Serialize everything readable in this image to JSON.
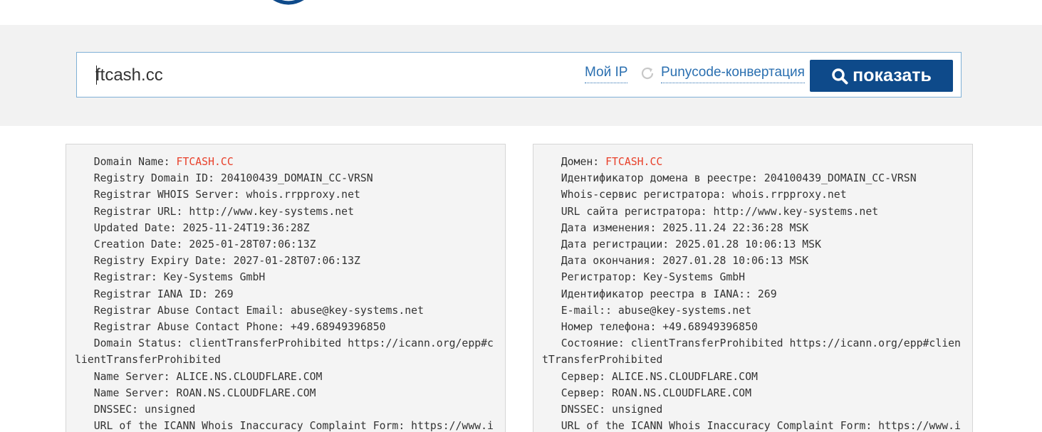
{
  "search": {
    "query": "ftcash.cc",
    "my_ip_label": "Мой IP",
    "punycode_label": "Punycode-конвертация",
    "show_label": "показать"
  },
  "colors": {
    "accent": "#0e4a8a",
    "link": "#2a6fb0",
    "highlight": "#e8402a",
    "band": "#f2f2f2",
    "panel": "#f4f4f4"
  },
  "icons": {
    "logo": "site-logo-arc",
    "refresh": "refresh-icon",
    "search": "search-icon"
  },
  "whois_original": [
    {
      "label": "   Domain Name: ",
      "value": "FTCASH.CC"
    },
    {
      "label": "   Registry Domain ID: 204100439_DOMAIN_CC-VRSN"
    },
    {
      "label": "   Registrar WHOIS Server: whois.rrpproxy.net"
    },
    {
      "label": "   Registrar URL: http://www.key-systems.net"
    },
    {
      "label": "   Updated Date: 2025-11-24T19:36:28Z"
    },
    {
      "label": "   Creation Date: 2025-01-28T07:06:13Z"
    },
    {
      "label": "   Registry Expiry Date: 2027-01-28T07:06:13Z"
    },
    {
      "label": "   Registrar: Key-Systems GmbH"
    },
    {
      "label": "   Registrar IANA ID: 269"
    },
    {
      "label": "   Registrar Abuse Contact Email: abuse@key-systems.net"
    },
    {
      "label": "   Registrar Abuse Contact Phone: +49.68949396850"
    },
    {
      "label": "   Domain Status: clientTransferProhibited https://icann.org/epp#clientTransferProhibited"
    },
    {
      "label": "   Name Server: ALICE.NS.CLOUDFLARE.COM"
    },
    {
      "label": "   Name Server: ROAN.NS.CLOUDFLARE.COM"
    },
    {
      "label": "   DNSSEC: unsigned"
    },
    {
      "label": "   URL of the ICANN Whois Inaccuracy Complaint Form: https://www.i"
    }
  ],
  "whois_translated": [
    {
      "label": "   Домен: ",
      "value": "FTCASH.CC"
    },
    {
      "label": "   Идентификатор домена в реестре: 204100439_DOMAIN_CC-VRSN"
    },
    {
      "label": "   Whois-сервис регистратора: whois.rrpproxy.net"
    },
    {
      "label": "   URL сайта регистратора: http://www.key-systems.net"
    },
    {
      "label": "   Дата изменения: 2025.11.24 22:36:28 MSK"
    },
    {
      "label": "   Дата регистрации: 2025.01.28 10:06:13 MSK"
    },
    {
      "label": "   Дата окончания: 2027.01.28 10:06:13 MSK"
    },
    {
      "label": "   Регистратор: Key-Systems GmbH"
    },
    {
      "label": "   Идентификатор реестра в IANA:: 269"
    },
    {
      "label": "   E-mail:: abuse@key-systems.net"
    },
    {
      "label": "   Номер телефона: +49.68949396850"
    },
    {
      "label": "   Состояние: clientTransferProhibited https://icann.org/epp#clientTransferProhibited"
    },
    {
      "label": "   Сервер: ALICE.NS.CLOUDFLARE.COM"
    },
    {
      "label": "   Сервер: ROAN.NS.CLOUDFLARE.COM"
    },
    {
      "label": "   DNSSEC: unsigned"
    },
    {
      "label": "   URL of the ICANN Whois Inaccuracy Complaint Form: https://www.i"
    }
  ]
}
